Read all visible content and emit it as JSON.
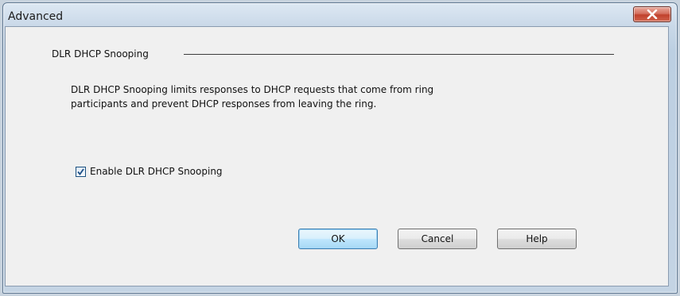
{
  "window": {
    "title": "Advanced",
    "close_icon": "close-icon"
  },
  "group": {
    "label": "DLR DHCP Snooping"
  },
  "description": {
    "line1": "DLR DHCP Snooping limits responses to DHCP requests that come from ring",
    "line2": "participants and prevent DHCP responses from leaving the ring."
  },
  "checkbox": {
    "label": "Enable DLR DHCP Snooping",
    "checked": true
  },
  "buttons": {
    "ok": "OK",
    "cancel": "Cancel",
    "help": "Help"
  },
  "colors": {
    "close_button": "#c0402c",
    "default_button_border": "#3c7fb1",
    "client_background": "#f0f0f0"
  }
}
